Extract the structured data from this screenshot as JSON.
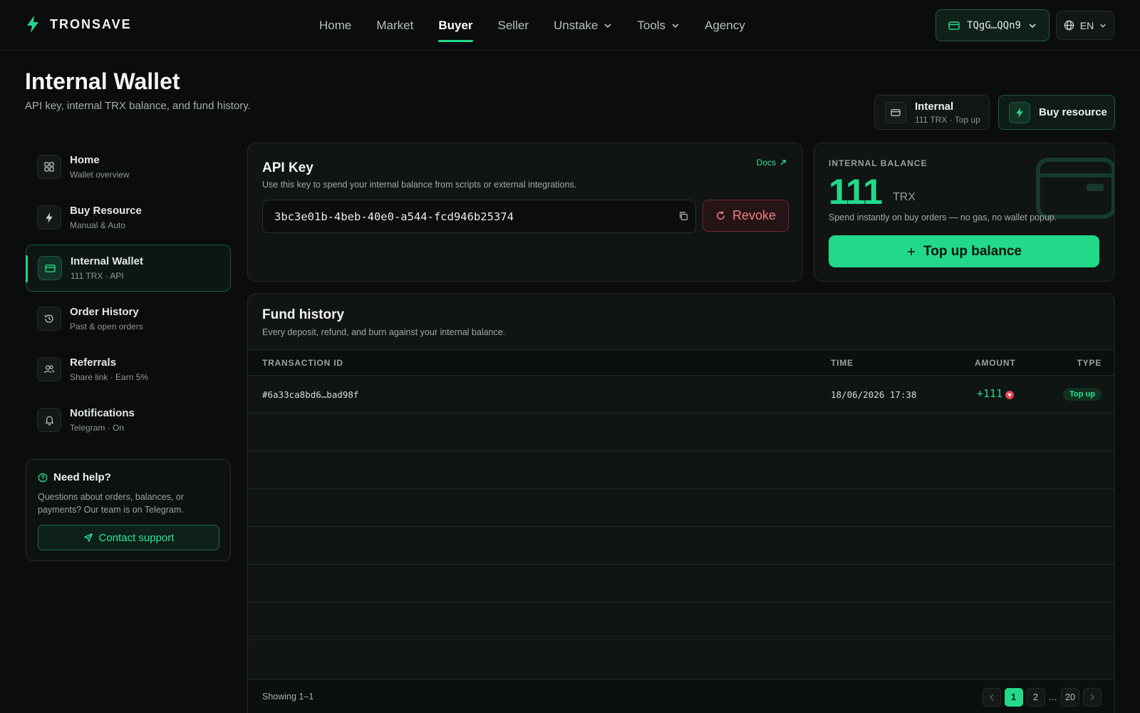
{
  "brand": {
    "name": "TRONSAVE"
  },
  "nav": {
    "items": [
      {
        "label": "Home"
      },
      {
        "label": "Market"
      },
      {
        "label": "Buyer"
      },
      {
        "label": "Seller"
      },
      {
        "label": "Unstake"
      },
      {
        "label": "Tools"
      },
      {
        "label": "Agency"
      }
    ],
    "active": "Buyer",
    "wallet_label": "TQgG…QQn9",
    "lang": "EN"
  },
  "header": {
    "title": "Internal Wallet",
    "subtitle": "API key, internal TRX balance, and fund history.",
    "internal_chip": {
      "title": "Internal",
      "sub": "111 TRX · Top up"
    },
    "buy_chip": {
      "label": "Buy resource"
    }
  },
  "sidebar": {
    "items": [
      {
        "title": "Home",
        "sub": "Wallet overview",
        "icon": "grid-icon"
      },
      {
        "title": "Buy Resource",
        "sub": "Manual & Auto",
        "icon": "bolt-icon"
      },
      {
        "title": "Internal Wallet",
        "sub": "111 TRX · API",
        "icon": "wallet-icon",
        "active": true
      },
      {
        "title": "Order History",
        "sub": "Past & open orders",
        "icon": "history-icon"
      },
      {
        "title": "Referrals",
        "sub": "Share link · Earn 5%",
        "icon": "users-icon"
      },
      {
        "title": "Notifications",
        "sub": "Telegram · On",
        "icon": "bell-icon"
      }
    ],
    "help": {
      "title": "Need help?",
      "text": "Questions about orders, balances, or payments? Our team is on Telegram.",
      "button": "Contact support"
    }
  },
  "api_key": {
    "title": "API Key",
    "subtitle": "Use this key to spend your internal balance from scripts or external integrations.",
    "docs_label": "Docs",
    "key": "3bc3e01b-4beb-40e0-a544-fcd946b25374",
    "revoke_label": "Revoke"
  },
  "balance": {
    "label": "INTERNAL BALANCE",
    "value": "111",
    "unit": "TRX",
    "note": "Spend instantly on buy orders — no gas, no wallet popup.",
    "topup_label": "Top up balance"
  },
  "history": {
    "title": "Fund history",
    "subtitle": "Every deposit, refund, and burn against your internal balance.",
    "columns": {
      "tx": "TRANSACTION ID",
      "time": "TIME",
      "amount": "AMOUNT",
      "type": "TYPE"
    },
    "rows": [
      {
        "tx": "#6a33ca8bd6…bad98f",
        "time": "18/06/2026 17:38",
        "amount": "+111",
        "type": "Top up"
      }
    ],
    "showing": "Showing 1–1",
    "pages": [
      "1",
      "2",
      "…",
      "20"
    ],
    "current_page": "1"
  },
  "colors": {
    "accent": "#22d98a",
    "background": "#0a0c0d",
    "danger": "#f07f7f"
  }
}
